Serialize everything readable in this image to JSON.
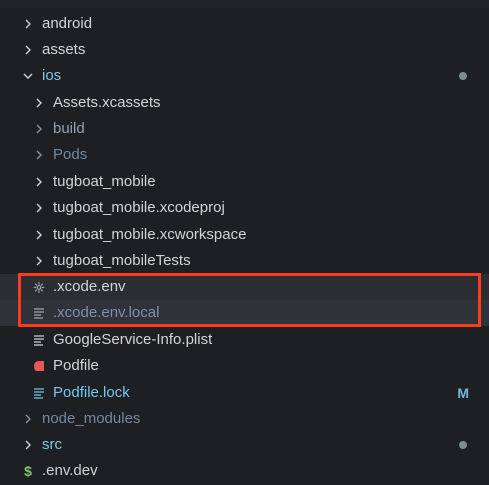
{
  "explorer": {
    "items": [
      {
        "label": "android",
        "type": "folder",
        "expanded": false,
        "depth": 0,
        "icon": "chevron-right-icon"
      },
      {
        "label": "assets",
        "type": "folder",
        "expanded": false,
        "depth": 0,
        "icon": "chevron-right-icon"
      },
      {
        "label": "ios",
        "type": "folder",
        "expanded": true,
        "depth": 0,
        "icon": "chevron-down-icon",
        "badge": "dot"
      },
      {
        "label": "Assets.xcassets",
        "type": "folder",
        "expanded": false,
        "depth": 1,
        "icon": "chevron-right-icon"
      },
      {
        "label": "build",
        "type": "folder",
        "expanded": false,
        "depth": 1,
        "icon": "chevron-right-icon"
      },
      {
        "label": "Pods",
        "type": "folder",
        "expanded": false,
        "depth": 1,
        "icon": "chevron-right-icon"
      },
      {
        "label": "tugboat_mobile",
        "type": "folder",
        "expanded": false,
        "depth": 1,
        "icon": "chevron-right-icon"
      },
      {
        "label": "tugboat_mobile.xcodeproj",
        "type": "folder",
        "expanded": false,
        "depth": 1,
        "icon": "chevron-right-icon"
      },
      {
        "label": "tugboat_mobile.xcworkspace",
        "type": "folder",
        "expanded": false,
        "depth": 1,
        "icon": "chevron-right-icon"
      },
      {
        "label": "tugboat_mobileTests",
        "type": "folder",
        "expanded": false,
        "depth": 1,
        "icon": "chevron-right-icon"
      },
      {
        "label": ".xcode.env",
        "type": "file",
        "depth": 1,
        "icon": "gear-icon"
      },
      {
        "label": ".xcode.env.local",
        "type": "file",
        "depth": 1,
        "icon": "lines-icon"
      },
      {
        "label": "GoogleService-Info.plist",
        "type": "file",
        "depth": 1,
        "icon": "lines-icon"
      },
      {
        "label": "Podfile",
        "type": "file",
        "depth": 1,
        "icon": "ruby-icon"
      },
      {
        "label": "Podfile.lock",
        "type": "file",
        "depth": 1,
        "icon": "lines-icon",
        "badge": "M"
      },
      {
        "label": "node_modules",
        "type": "folder",
        "expanded": false,
        "depth": 0,
        "icon": "chevron-right-icon"
      },
      {
        "label": "src",
        "type": "folder",
        "expanded": false,
        "depth": 0,
        "icon": "chevron-right-icon",
        "badge": "dot"
      },
      {
        "label": ".env.dev",
        "type": "file",
        "depth": 0,
        "icon": "dollar-icon"
      }
    ],
    "highlighted_items": [
      ".xcode.env",
      ".xcode.env.local"
    ],
    "colors": {
      "background": "#1e1f22",
      "folder_text": "#d4d4d4",
      "ios_text": "#7ec9e6",
      "muted_text": "#8fa2b7",
      "dimmed_text": "#6e8aa5",
      "modified_text": "#72c6f2",
      "highlight": "#ff3b1f",
      "modified_badge": "#77b5e1",
      "dot_badge": "#7f8c8d"
    }
  }
}
